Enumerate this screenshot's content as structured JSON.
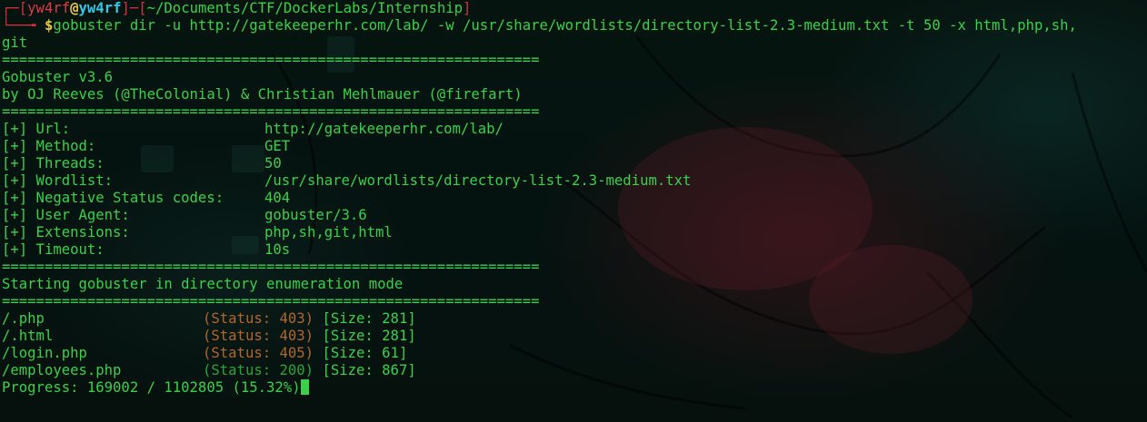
{
  "prompt": {
    "user": "yw4rf",
    "at": "@",
    "host": "yw4rf",
    "cwd": "~/Documents/CTF/DockerLabs/Internship",
    "symbol": "$",
    "command_line1": "gobuster dir -u http://gatekeeperhr.com/lab/ -w /usr/share/wordlists/directory-list-2.3-medium.txt -t 50 -x html,php,sh,",
    "command_line2": "git"
  },
  "separator": "===============================================================",
  "banner": {
    "title": "Gobuster v3.6",
    "authors": "by OJ Reeves (@TheColonial) & Christian Mehlmauer (@firefart)"
  },
  "config": [
    {
      "label": "[+] Url:",
      "value": "http://gatekeeperhr.com/lab/"
    },
    {
      "label": "[+] Method:",
      "value": "GET"
    },
    {
      "label": "[+] Threads:",
      "value": "50"
    },
    {
      "label": "[+] Wordlist:",
      "value": "/usr/share/wordlists/directory-list-2.3-medium.txt"
    },
    {
      "label": "[+] Negative Status codes:",
      "value": "404"
    },
    {
      "label": "[+] User Agent:",
      "value": "gobuster/3.6"
    },
    {
      "label": "[+] Extensions:",
      "value": "php,sh,git,html"
    },
    {
      "label": "[+] Timeout:",
      "value": "10s"
    }
  ],
  "mode_message": "Starting gobuster in directory enumeration mode",
  "results": [
    {
      "path": "/.php",
      "status": "(Status: 403)",
      "size": "[Size: 281]",
      "status_color": "#b0672c"
    },
    {
      "path": "/.html",
      "status": "(Status: 403)",
      "size": "[Size: 281]",
      "status_color": "#b0672c"
    },
    {
      "path": "/login.php",
      "status": "(Status: 405)",
      "size": "[Size: 61]",
      "status_color": "#b0672c"
    },
    {
      "path": "/employees.php",
      "status": "(Status: 200)",
      "size": "[Size: 867]",
      "status_color": "#2aa43a"
    }
  ],
  "progress": "Progress: 169002 / 1102805 (15.32%)",
  "colors": {
    "text": "#3ad04a",
    "prompt_bracket": "#d6303e",
    "host": "#33c8e8",
    "status_forbidden": "#b0672c",
    "status_ok": "#2aa43a"
  }
}
